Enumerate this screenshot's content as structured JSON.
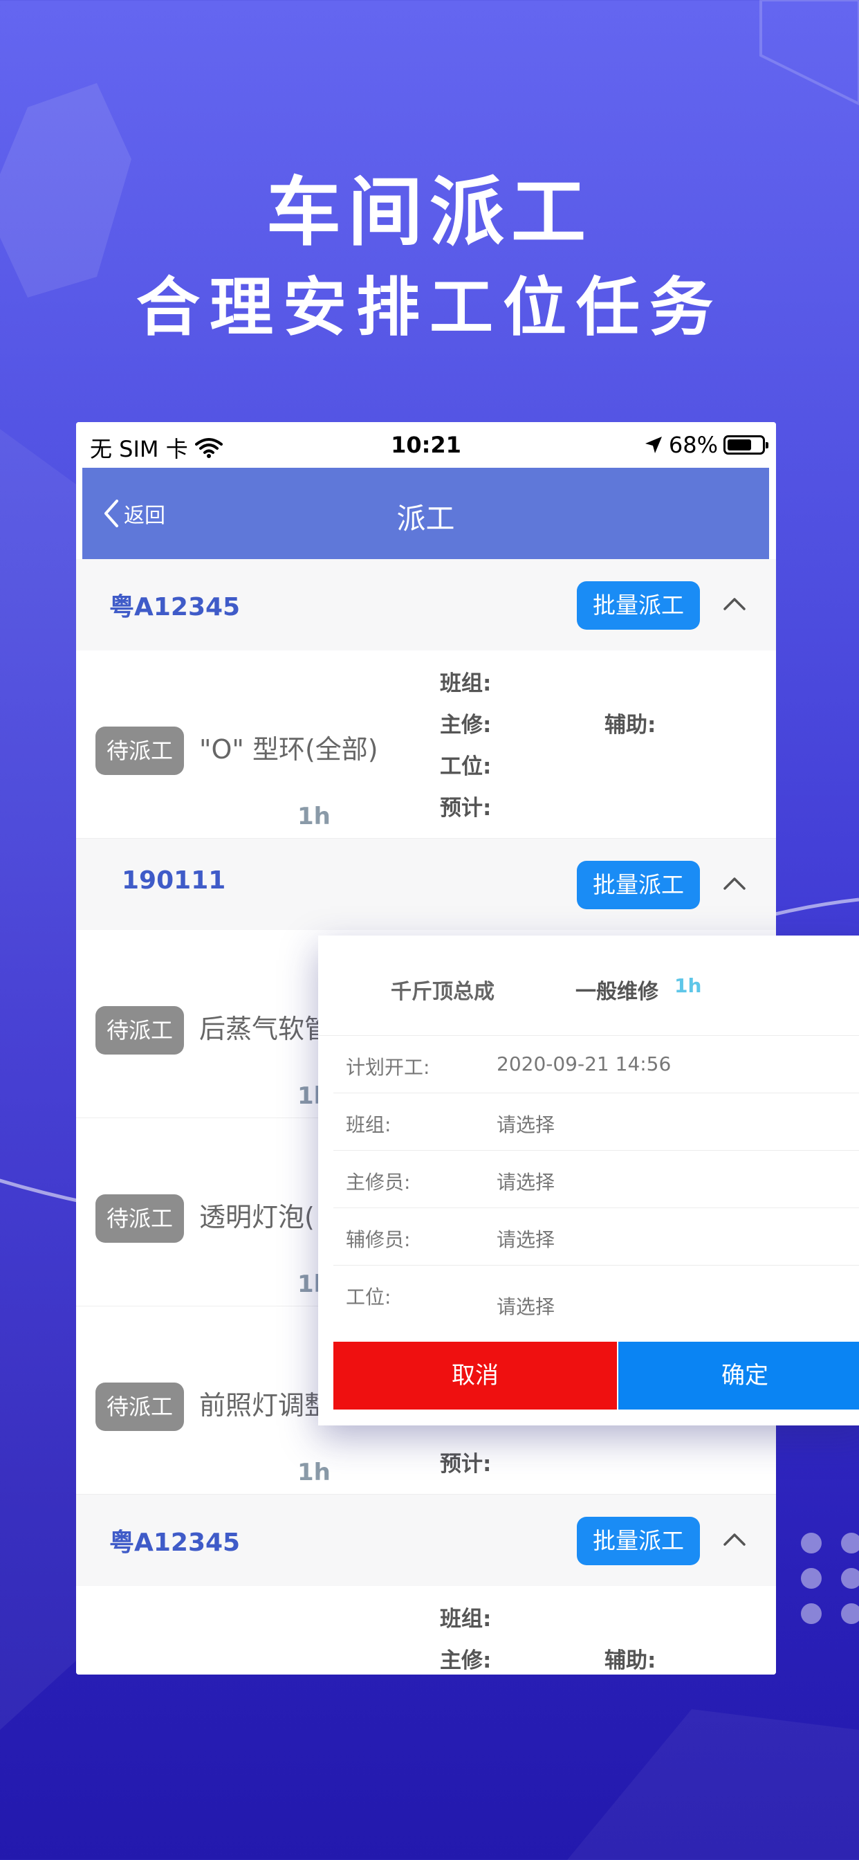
{
  "hero": {
    "title": "车间派工",
    "subtitle": "合理安排工位任务"
  },
  "status_bar": {
    "carrier": "无 SIM 卡",
    "time": "10:21",
    "battery": "68%"
  },
  "navbar": {
    "back_label": "返回",
    "title": "派工"
  },
  "groups": [
    {
      "plate": "粤A12345",
      "batch_label": "批量派工",
      "items": [
        {
          "status": "待派工",
          "name": "\"O\" 型环(全部)",
          "hours": "1h",
          "team_label": "班组:",
          "main_label": "主修:",
          "assist_label": "辅助:",
          "station_label": "工位:",
          "estimate_label": "预计:"
        }
      ]
    },
    {
      "plate": "190111",
      "batch_label": "批量派工",
      "items": [
        {
          "status": "待派工",
          "name": "后蒸气软管",
          "hours": "1h"
        },
        {
          "status": "待派工",
          "name": "透明灯泡(",
          "hours": "1h"
        },
        {
          "status": "待派工",
          "name": "前照灯调整",
          "hours": "1h",
          "estimate_label": "预计:"
        }
      ]
    },
    {
      "plate": "粤A12345",
      "batch_label": "批量派工",
      "items": [
        {
          "team_label": "班组:",
          "main_label": "主修:",
          "assist_label": "辅助:"
        }
      ]
    }
  ],
  "popup": {
    "name": "千斤顶总成",
    "repair_type": "一般维修",
    "hours": "1h",
    "rows": [
      {
        "label": "计划开工:",
        "value": "2020-09-21 14:56"
      },
      {
        "label": "班组:",
        "value": "请选择"
      },
      {
        "label": "主修员:",
        "value": "请选择"
      },
      {
        "label": "辅修员:",
        "value": "请选择"
      },
      {
        "label": "工位:",
        "value": "请选择"
      }
    ],
    "cancel_label": "取消",
    "confirm_label": "确定"
  },
  "colors": {
    "background_top": "#6466f0",
    "background_bottom": "#2319ad",
    "navbar": "#5f78d9",
    "batch_button": "#1a8cf5",
    "status_tag": "#8d8d8d",
    "cancel": "#ef1010",
    "confirm": "#0a84f3",
    "plate_text": "#3f5bc8"
  }
}
